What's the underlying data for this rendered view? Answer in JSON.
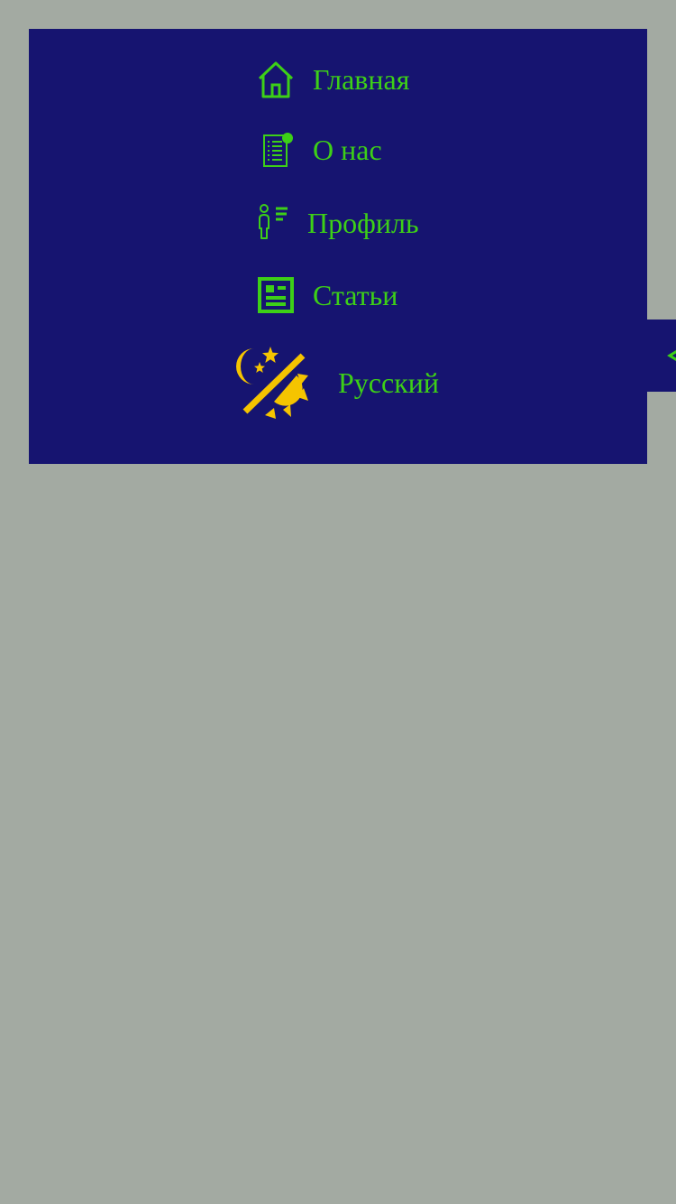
{
  "nav": {
    "items": [
      {
        "label": "Главная",
        "icon": "home-icon"
      },
      {
        "label": "О нас",
        "icon": "document-icon"
      },
      {
        "label": "Профиль",
        "icon": "person-list-icon"
      },
      {
        "label": "Статьи",
        "icon": "newspaper-icon"
      }
    ],
    "language": {
      "label": "Русский"
    },
    "theme_toggle": {
      "icon": "day-night-icon"
    },
    "side_tab": {
      "icon": "chevron-left-icon"
    }
  },
  "colors": {
    "page_background": "#a3aaa2",
    "panel_background": "#161470",
    "accent_green": "#3dd017",
    "theme_icon_yellow": "#f5c400"
  }
}
